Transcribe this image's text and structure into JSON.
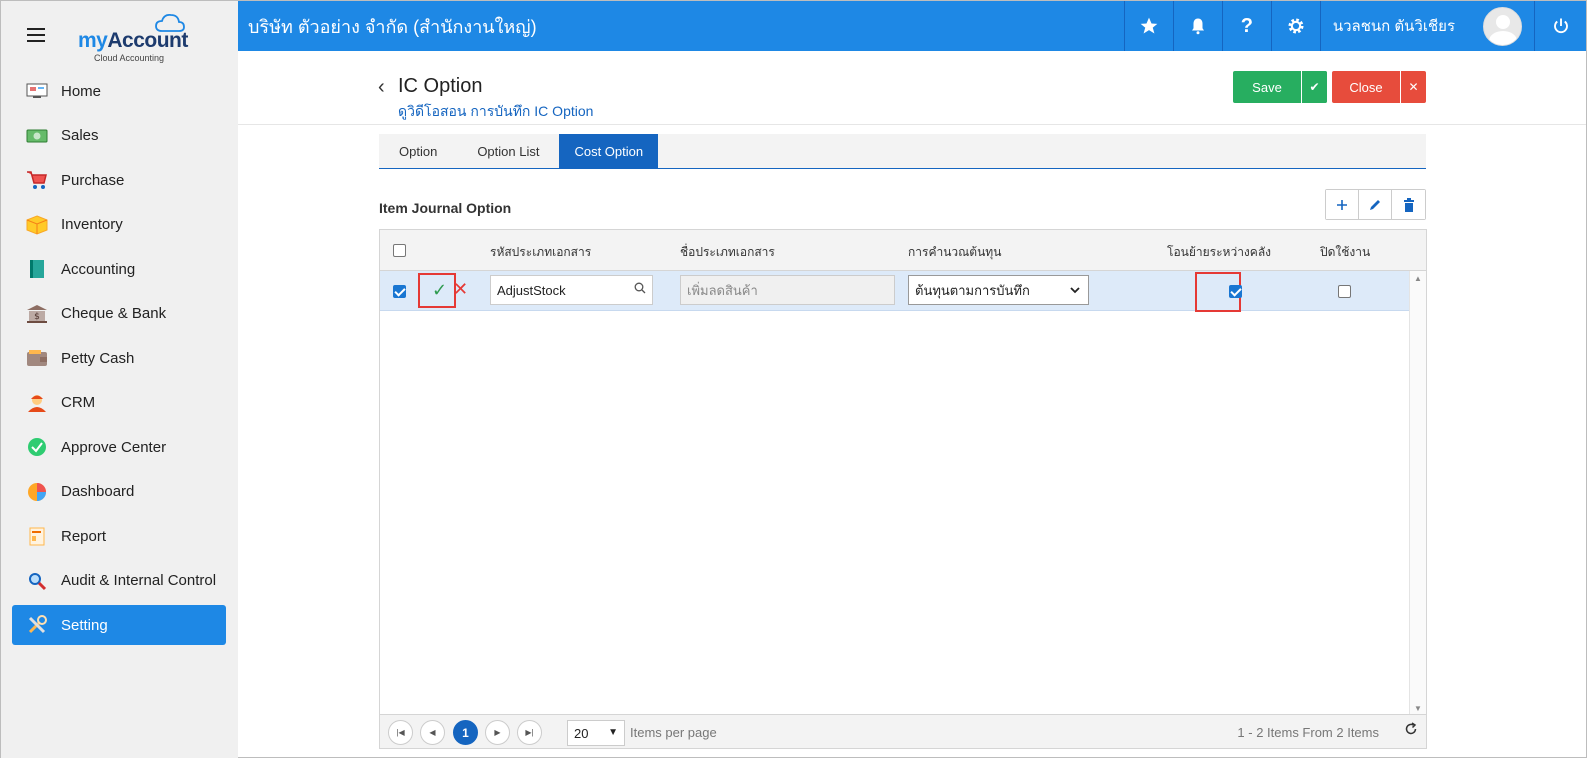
{
  "app": {
    "logo_my": "my",
    "logo_account": "Account",
    "logo_sub": "Cloud Accounting"
  },
  "sidebar": {
    "items": [
      {
        "label": "Home",
        "icon": "home-icon"
      },
      {
        "label": "Sales",
        "icon": "sales-icon"
      },
      {
        "label": "Purchase",
        "icon": "cart-icon"
      },
      {
        "label": "Inventory",
        "icon": "box-icon"
      },
      {
        "label": "Accounting",
        "icon": "book-icon"
      },
      {
        "label": "Cheque & Bank",
        "icon": "bank-icon"
      },
      {
        "label": "Petty Cash",
        "icon": "wallet-icon"
      },
      {
        "label": "CRM",
        "icon": "person-icon"
      },
      {
        "label": "Approve Center",
        "icon": "check-circle-icon"
      },
      {
        "label": "Dashboard",
        "icon": "pie-chart-icon"
      },
      {
        "label": "Report",
        "icon": "report-icon"
      },
      {
        "label": "Audit & Internal Control",
        "icon": "magnifier-icon"
      },
      {
        "label": "Setting",
        "icon": "tools-icon"
      }
    ],
    "active": "Setting"
  },
  "topbar": {
    "company": "บริษัท ตัวอย่าง จำกัด (สำนักงานใหญ่)",
    "user_name": "นวลชนก ตันวิเชียร"
  },
  "header": {
    "title": "IC Option",
    "subtitle": "ดูวิดีโอสอน การบันทึก IC Option",
    "save_label": "Save",
    "close_label": "Close"
  },
  "tabs": [
    {
      "label": "Option"
    },
    {
      "label": "Option List"
    },
    {
      "label": "Cost Option"
    }
  ],
  "active_tab": "Cost Option",
  "section": {
    "title": "Item Journal Option"
  },
  "grid": {
    "columns": {
      "doc_code": "รหัสประเภทเอกสาร",
      "doc_name": "ชื่อประเภทเอกสาร",
      "cost_calc": "การคำนวณต้นทุน",
      "transfer": "โอนย้ายระหว่างคลัง",
      "disabled": "ปิดใช้งาน"
    },
    "row": {
      "selected": true,
      "doc_code": "AdjustStock",
      "doc_name_placeholder": "เพิ่มลดสินค้า",
      "cost_calc": "ต้นทุนตามการบันทึก",
      "transfer": true,
      "disabled": false
    }
  },
  "pager": {
    "current_page": "1",
    "page_size": "20",
    "items_per_page_label": "Items per page",
    "summary": "1 - 2 Items From 2 Items"
  },
  "colors": {
    "primary": "#1e88e5",
    "save": "#27ae60",
    "close": "#e74c3c",
    "highlight": "#e53935"
  }
}
